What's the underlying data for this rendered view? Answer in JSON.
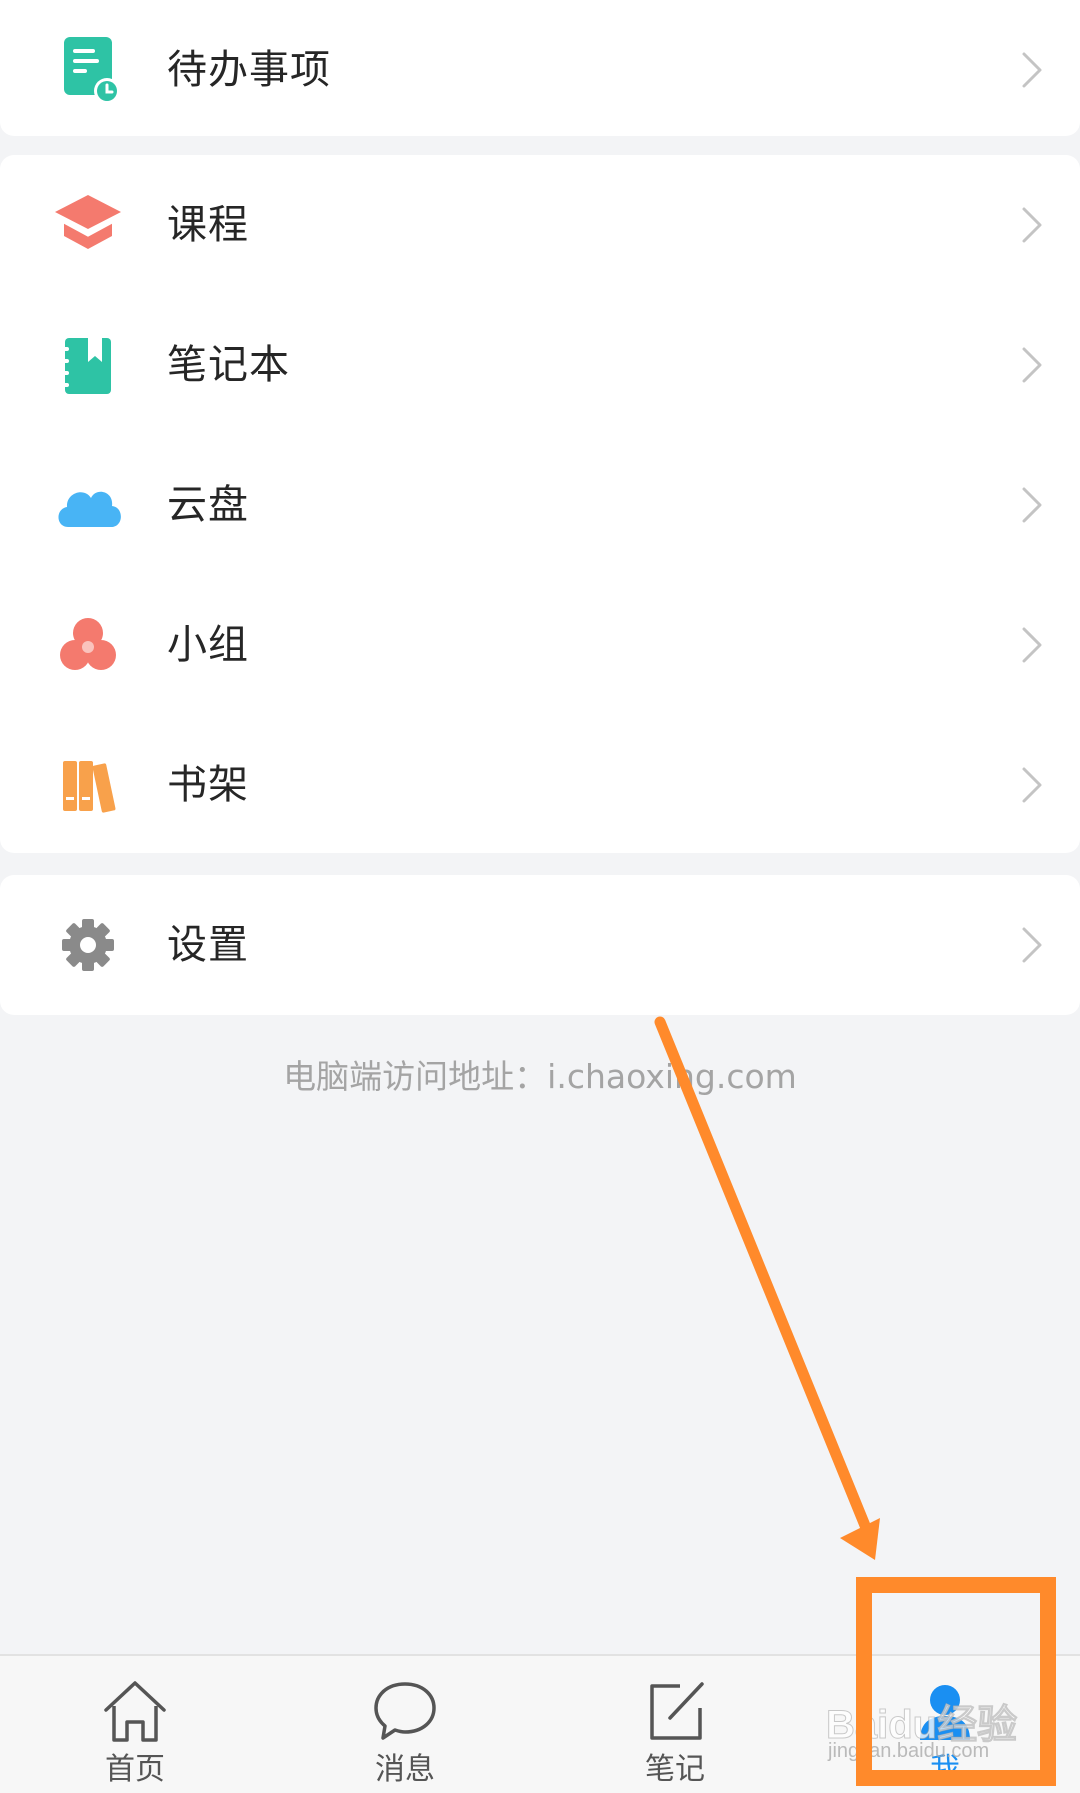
{
  "menu": {
    "todo_label": "待办事项",
    "course_label": "课程",
    "notebook_label": "笔记本",
    "cloud_label": "云盘",
    "group_label": "小组",
    "bookshelf_label": "书架",
    "settings_label": "设置"
  },
  "footer_note": "电脑端访问地址：i.chaoxing.com",
  "tabs": {
    "home_label": "首页",
    "messages_label": "消息",
    "notes_label": "笔记",
    "me_label": "我",
    "active": "me"
  },
  "watermark": {
    "main": "Baidu经验",
    "sub": "jingyan.baidu.com"
  },
  "colors": {
    "todo_icon": "#2ec3a5",
    "course_icon": "#f47a6e",
    "notebook_icon": "#2ec3a5",
    "cloud_icon": "#48b4f5",
    "group_icon": "#f47a6e",
    "bookshelf_icon": "#f8a14b",
    "settings_icon": "#8a8a8a",
    "active_tab": "#1a8ff2",
    "annotation": "#ff8a2b"
  }
}
